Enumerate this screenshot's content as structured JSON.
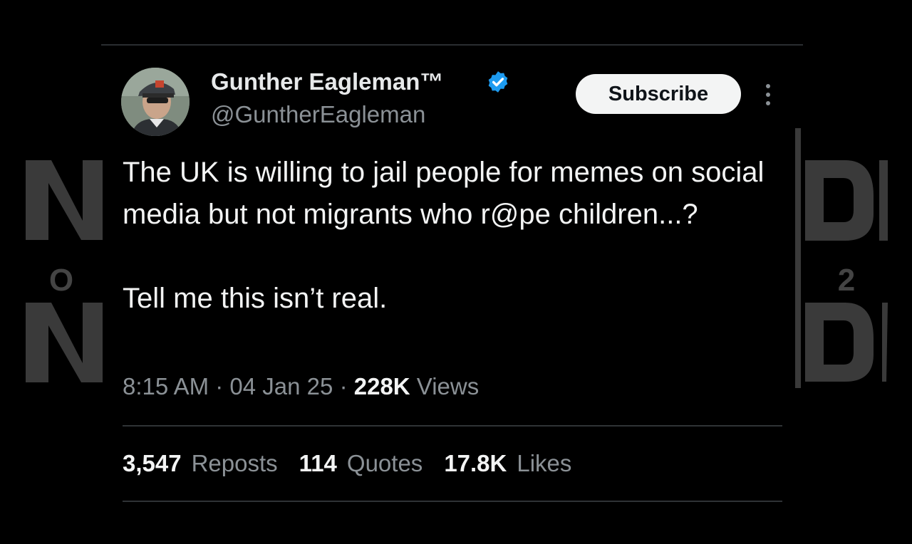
{
  "background": {
    "left_letters": [
      "N",
      "O",
      "N"
    ],
    "right_letters": [
      "D",
      "2",
      "D"
    ]
  },
  "author": {
    "display_name": "Gunther Eagleman™",
    "handle": "@GuntherEagleman",
    "verified_icon": "verified-badge-icon",
    "verified_color": "#1d9bf0"
  },
  "actions": {
    "subscribe_label": "Subscribe",
    "more_icon": "more-vertical-icon"
  },
  "tweet": {
    "paragraphs": [
      "The UK is willing to jail people for memes on social media but not migrants who r@pe children...?",
      "Tell me this isn’t real."
    ]
  },
  "meta": {
    "time": "8:15 AM",
    "separator": "·",
    "date": "04 Jan 25",
    "views_count": "228K",
    "views_label": "Views"
  },
  "stats": [
    {
      "count": "3,547",
      "label": "Reposts"
    },
    {
      "count": "114",
      "label": "Quotes"
    },
    {
      "count": "17.8K",
      "label": "Likes"
    }
  ]
}
